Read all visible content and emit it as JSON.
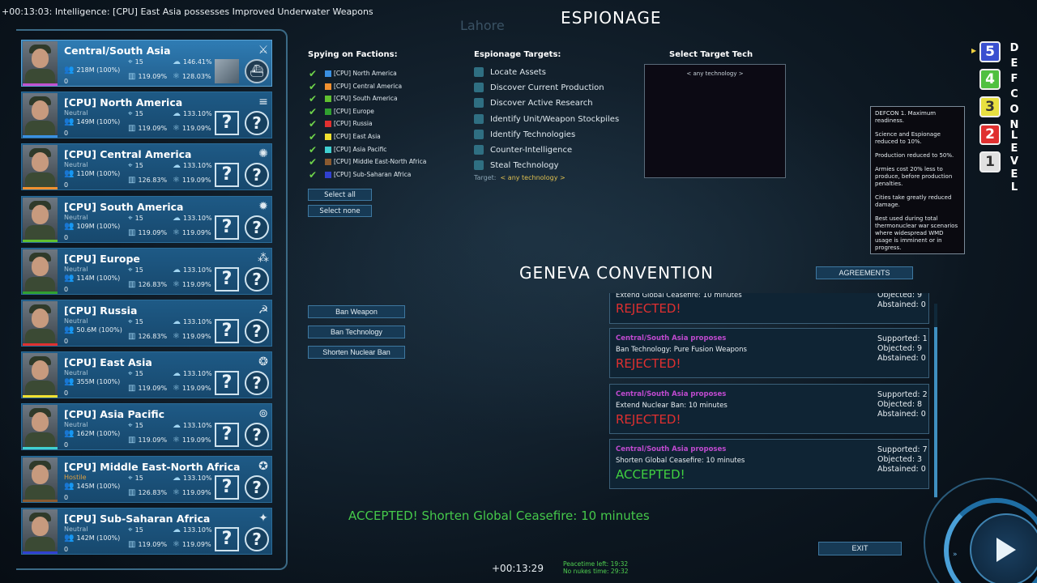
{
  "ticker": "+00:13:03: Intelligence: [CPU] East Asia possesses Improved Underwater Weapons",
  "map_city": "Lahore",
  "espionage_title": "ESPIONAGE",
  "geneva_title": "GENEVA CONVENTION",
  "factions": [
    {
      "name": "Central/South Asia",
      "status": "",
      "pop": "218M (100%)",
      "zero": "0",
      "a": "15",
      "b": "146.41%",
      "c": "119.09%",
      "d": "128.03%",
      "color": "#c050d0",
      "emblem": "crossed-swords-icon",
      "glyph": "⚔",
      "selected": true
    },
    {
      "name": "[CPU] North America",
      "status": "Neutral",
      "pop": "149M (100%)",
      "zero": "0",
      "a": "15",
      "b": "133.10%",
      "c": "119.09%",
      "d": "119.09%",
      "color": "#3a8fe0",
      "emblem": "flag-icon",
      "glyph": "≡",
      "selected": false
    },
    {
      "name": "[CPU] Central America",
      "status": "Neutral",
      "pop": "110M (100%)",
      "zero": "0",
      "a": "15",
      "b": "133.10%",
      "c": "126.83%",
      "d": "119.09%",
      "color": "#f09030",
      "emblem": "eagle-icon",
      "glyph": "✺",
      "selected": false
    },
    {
      "name": "[CPU] South America",
      "status": "Neutral",
      "pop": "109M (100%)",
      "zero": "0",
      "a": "15",
      "b": "133.10%",
      "c": "119.09%",
      "d": "119.09%",
      "color": "#60c030",
      "emblem": "sun-icon",
      "glyph": "✹",
      "selected": false
    },
    {
      "name": "[CPU] Europe",
      "status": "Neutral",
      "pop": "114M (100%)",
      "zero": "0",
      "a": "15",
      "b": "133.10%",
      "c": "126.83%",
      "d": "119.09%",
      "color": "#30a030",
      "emblem": "stars-ring-icon",
      "glyph": "⁂",
      "selected": false
    },
    {
      "name": "[CPU] Russia",
      "status": "Neutral",
      "pop": "50.6M (100%)",
      "zero": "0",
      "a": "15",
      "b": "133.10%",
      "c": "126.83%",
      "d": "119.09%",
      "color": "#e03030",
      "emblem": "hammer-sickle-icon",
      "glyph": "☭",
      "selected": false
    },
    {
      "name": "[CPU] East Asia",
      "status": "Neutral",
      "pop": "355M (100%)",
      "zero": "0",
      "a": "15",
      "b": "133.10%",
      "c": "119.09%",
      "d": "119.09%",
      "color": "#f0e030",
      "emblem": "dragon-icon",
      "glyph": "❂",
      "selected": false
    },
    {
      "name": "[CPU] Asia Pacific",
      "status": "Neutral",
      "pop": "162M (100%)",
      "zero": "0",
      "a": "15",
      "b": "133.10%",
      "c": "119.09%",
      "d": "119.09%",
      "color": "#40d0d0",
      "emblem": "seal-icon",
      "glyph": "⊚",
      "selected": false
    },
    {
      "name": "[CPU] Middle East-North Africa",
      "status": "Hostile",
      "pop": "145M (100%)",
      "zero": "0",
      "a": "15",
      "b": "133.10%",
      "c": "126.83%",
      "d": "119.09%",
      "color": "#8a5a30",
      "emblem": "wreath-icon",
      "glyph": "✪",
      "selected": false
    },
    {
      "name": "[CPU] Sub-Saharan Africa",
      "status": "Neutral",
      "pop": "142M (100%)",
      "zero": "0",
      "a": "15",
      "b": "133.10%",
      "c": "119.09%",
      "d": "119.09%",
      "color": "#3040d0",
      "emblem": "globe-icon",
      "glyph": "✦",
      "selected": false
    }
  ],
  "spying": {
    "header": "Spying on Factions:",
    "items": [
      {
        "label": "[CPU] North America",
        "color": "#3a8fe0"
      },
      {
        "label": "[CPU] Central America",
        "color": "#f09030"
      },
      {
        "label": "[CPU] South America",
        "color": "#60c030"
      },
      {
        "label": "[CPU] Europe",
        "color": "#30a030"
      },
      {
        "label": "[CPU] Russia",
        "color": "#e03030"
      },
      {
        "label": "[CPU] East Asia",
        "color": "#f0e030"
      },
      {
        "label": "[CPU] Asia Pacific",
        "color": "#40d0d0"
      },
      {
        "label": "[CPU] Middle East-North Africa",
        "color": "#8a5a30"
      },
      {
        "label": "[CPU] Sub-Saharan Africa",
        "color": "#3040d0"
      }
    ],
    "select_all": "Select all",
    "select_none": "Select none"
  },
  "targets": {
    "header": "Espionage Targets:",
    "items": [
      "Locate Assets",
      "Discover Current Production",
      "Discover Active Research",
      "Identify Unit/Weapon Stockpiles",
      "Identify Technologies",
      "Counter-Intelligence",
      "Steal Technology"
    ],
    "target_prefix": "Target:",
    "target_value": "< any technology >"
  },
  "tech": {
    "header": "Select Target Tech",
    "any": "< any technology >"
  },
  "defcon": {
    "letters": [
      "D",
      "E",
      "F",
      "C",
      "O",
      "N",
      "L",
      "E",
      "V",
      "E",
      "L"
    ],
    "levels": [
      {
        "n": "5",
        "color": "#3a50d0",
        "text": "#ffffff"
      },
      {
        "n": "4",
        "color": "#50c040",
        "text": "#ffffff"
      },
      {
        "n": "3",
        "color": "#e8e040",
        "text": "#333333"
      },
      {
        "n": "2",
        "color": "#e03030",
        "text": "#ffffff"
      },
      {
        "n": "1",
        "color": "#e0e0e0",
        "text": "#333333"
      }
    ],
    "tooltip": [
      "DEFCON 1. Maximum readiness.",
      "Science and Espionage reduced to 10%.",
      "Production reduced to 50%.",
      "Armies cost 20% less to produce, before production penalties.",
      "Cities take greatly reduced damage.",
      "Best used during total thermonuclear war scenarios where widespread WMD usage is imminent or in progress."
    ]
  },
  "geneva": {
    "ban_weapon": "Ban Weapon",
    "ban_technology": "Ban Technology",
    "shorten_nuclear_ban": "Shorten Nuclear Ban",
    "agreements": "AGREEMENTS",
    "partial": {
      "desc": "Extend Global Ceasefire: 10 minutes",
      "result": "REJECTED!",
      "objected": "Objected: 9",
      "abstained": "Abstained: 0"
    },
    "proposals": [
      {
        "by": "Central/South Asia proposes",
        "desc": "Ban Technology: Pure Fusion Weapons",
        "result": "REJECTED!",
        "accepted": false,
        "supported": "Supported: 1",
        "objected": "Objected: 9",
        "abstained": "Abstained: 0"
      },
      {
        "by": "Central/South Asia proposes",
        "desc": "Extend Nuclear Ban: 10 minutes",
        "result": "REJECTED!",
        "accepted": false,
        "supported": "Supported: 2",
        "objected": "Objected: 8",
        "abstained": "Abstained: 0"
      },
      {
        "by": "Central/South Asia proposes",
        "desc": "Shorten Global Ceasefire: 10 minutes",
        "result": "ACCEPTED!",
        "accepted": true,
        "supported": "Supported: 7",
        "objected": "Objected: 3",
        "abstained": "Abstained: 0"
      }
    ],
    "accept_message": "ACCEPTED! Shorten Global Ceasefire: 10 minutes"
  },
  "footer": {
    "exit": "EXIT",
    "clock": "+00:13:29",
    "peacetime": "Peacetime left: 19:32",
    "nonukes": "No nukes time: 29:32",
    "ff": "»"
  }
}
